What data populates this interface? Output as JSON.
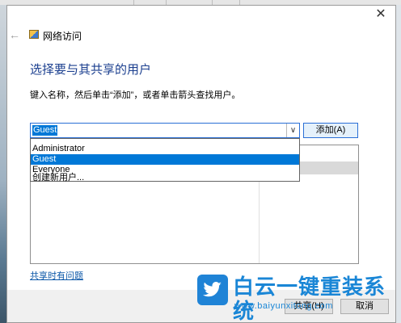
{
  "window": {
    "close_glyph": "✕",
    "back_glyph": "←",
    "title": "网络访问",
    "heading": "选择要与其共享的用户",
    "instruction": "键入名称，然后单击“添加”，或者单击箭头查找用户。"
  },
  "combo": {
    "value": "Guest",
    "arrow_glyph": "∨"
  },
  "add_button": {
    "label": "添加(A)"
  },
  "dropdown": {
    "options": [
      {
        "label": "Administrator",
        "selected": false
      },
      {
        "label": "Guest",
        "selected": true
      },
      {
        "label": "Everyone",
        "selected": false
      },
      {
        "label": "创建新用户...",
        "selected": false
      }
    ]
  },
  "help_link": {
    "label": "共享时有问题"
  },
  "footer": {
    "share_label": "共享(H)",
    "cancel_label": "取消"
  },
  "watermark": {
    "title": "白云一键重装系统",
    "url": "www.baiyunxitong.com",
    "icon": "twitter-bird-icon",
    "color": "#1a86d6"
  },
  "colors": {
    "heading": "#1b3f8f",
    "selection": "#0078d7",
    "link": "#0b57a8"
  }
}
